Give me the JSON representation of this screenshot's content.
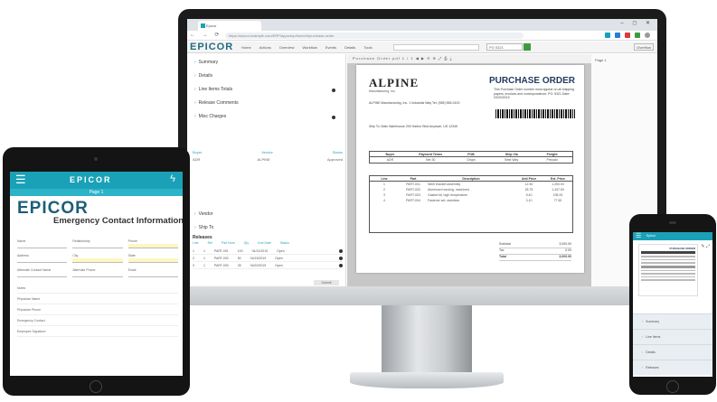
{
  "monitor": {
    "browser": {
      "tab_title": "Epicor",
      "window_controls": "– ◻ ✕",
      "nav_buttons": "← → ⟳ ⌂",
      "url": "https://epicor.example.com/ERP/apps/erp/home/#/purchase-order"
    },
    "appbar": {
      "logo": "EPICOR",
      "menu": [
        "Home",
        "Actions",
        "Overview",
        "Workflow",
        "Events",
        "Details",
        "Tools"
      ],
      "order_field": "PO 5321",
      "overflow": "Overflow"
    },
    "left_panel": {
      "items": [
        "Summary",
        "Details",
        "Line Items Totals",
        "Release Comments",
        "Misc Charges"
      ],
      "field_labels": [
        "Buyer",
        "Vendor",
        "Status"
      ],
      "field_values": [
        "ADR",
        "ALPINE",
        "Approved"
      ],
      "section_items": [
        "Vendor",
        "Ship To"
      ],
      "table_title": "Releases",
      "table_headers": [
        "Line",
        "Rel",
        "Part Num",
        "Qty",
        "Due Date",
        "Status"
      ],
      "table_rows": [
        [
          "1",
          "1",
          "PART-001",
          "100",
          "04/12/2019",
          "Open"
        ],
        [
          "2",
          "1",
          "PART-002",
          "50",
          "04/15/2019",
          "Open"
        ],
        [
          "3",
          "1",
          "PART-003",
          "25",
          "04/20/2019",
          "Open"
        ]
      ],
      "button": "Submit"
    },
    "viewer": {
      "toolbar": "Purchase Order.pdf   1 / 1   ◀ ▶ ⊖ ⊕ ⤢ ⎙ ⤓",
      "side_label": "Page 1",
      "doc": {
        "company": "ALPINE",
        "company_sub": "Manufacturing, Inc.",
        "po_title": "PURCHASE ORDER",
        "po_text": "This Purchase Order number must appear on all shipping papers, invoices and correspondence. PO: 5321   Date: 03/20/2019",
        "vendor_addr": "ALPINE Manufacturing, Inc. 1 Industrial Way Tel: (555) 555-0100",
        "ship_addr": "Ship To: Main Warehouse 200 Harbor Blvd Anytown, US 12345",
        "info_headers": [
          "Buyer",
          "Payment Terms",
          "FOB",
          "Ship Via",
          "Freight"
        ],
        "info_values": [
          "ADR",
          "Net 30",
          "Origin",
          "Best Way",
          "Prepaid"
        ],
        "line_headers": [
          "Line",
          "Part",
          "Description",
          "Unit Price",
          "Ext. Price"
        ],
        "lines": [
          [
            "1",
            "PART-001",
            "Steel bracket assembly",
            "12.50",
            "1,250.00"
          ],
          [
            "2",
            "PART-002",
            "Aluminum housing, machined",
            "28.75",
            "1,437.50"
          ],
          [
            "3",
            "PART-003",
            "Gasket kit, high temperature",
            "9.40",
            "235.00"
          ],
          [
            "4",
            "PART-004",
            "Fastener set, stainless",
            "3.10",
            "77.50"
          ]
        ],
        "totals": [
          [
            "Subtotal",
            "3,000.00"
          ],
          [
            "Tax",
            "0.00"
          ],
          [
            "Total",
            "3,000.00"
          ]
        ]
      }
    }
  },
  "tablet": {
    "header_logo": "EPICOR",
    "subbar": "Page 1",
    "brand": "EPICOR",
    "form_title": "Emergency Contact Information",
    "rows": [
      [
        "Name",
        "Relationship",
        "Phone"
      ],
      [
        "Address",
        "City",
        "State"
      ],
      [
        "Alternate Contact Name",
        "Alternate Phone",
        "Email"
      ]
    ],
    "lines": [
      "Notes",
      "Physician Name",
      "Physician Phone",
      "Emergency Contact",
      "Employee Signature"
    ]
  },
  "phone": {
    "header_label": "Epicor",
    "doc_title": "PURCHASE ORDER",
    "icons": "✎ ⤢",
    "items": [
      "Summary",
      "Line Items",
      "Details",
      "Releases"
    ]
  },
  "colors": {
    "epicor_teal": "#1aa1b7",
    "epicor_blue": "#1d5e78",
    "po_navy": "#1d3b5e",
    "green_button": "#3d9b3d"
  }
}
